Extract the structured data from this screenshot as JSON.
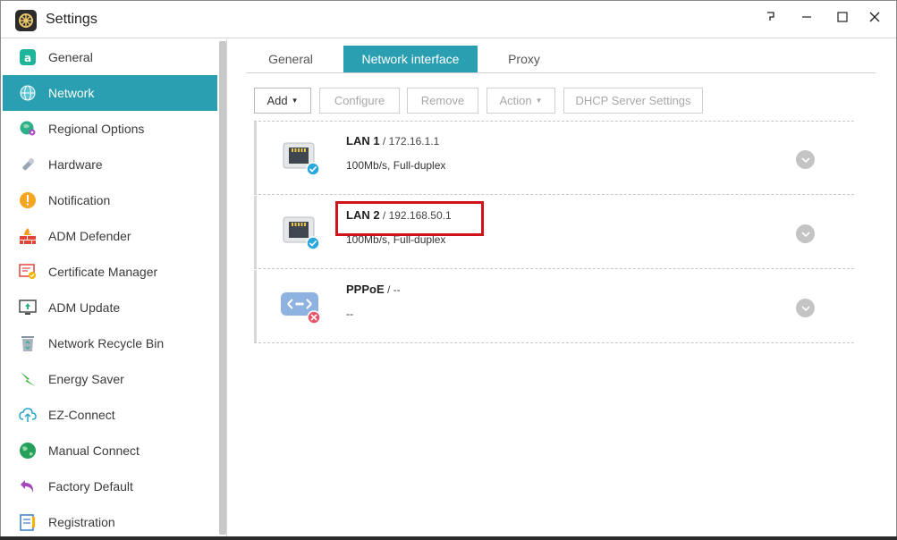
{
  "window": {
    "title": "Settings",
    "controls": {
      "help": "help-icon",
      "minimize": "minimize-icon",
      "maximize": "maximize-icon",
      "close": "close-icon"
    }
  },
  "sidebar": {
    "active_color": "#2a9fb1",
    "items": [
      {
        "label": "General",
        "icon": "general-icon"
      },
      {
        "label": "Network",
        "icon": "globe-icon",
        "active": true
      },
      {
        "label": "Regional Options",
        "icon": "globe-pin-icon"
      },
      {
        "label": "Hardware",
        "icon": "wrench-icon"
      },
      {
        "label": "Notification",
        "icon": "alert-icon"
      },
      {
        "label": "ADM Defender",
        "icon": "firewall-icon"
      },
      {
        "label": "Certificate Manager",
        "icon": "certificate-icon"
      },
      {
        "label": "ADM Update",
        "icon": "update-monitor-icon"
      },
      {
        "label": "Network Recycle Bin",
        "icon": "recycle-bin-icon"
      },
      {
        "label": "Energy Saver",
        "icon": "energy-icon"
      },
      {
        "label": "EZ-Connect",
        "icon": "cloud-upload-icon"
      },
      {
        "label": "Manual Connect",
        "icon": "globe-green-icon"
      },
      {
        "label": "Factory Default",
        "icon": "undo-arrow-icon"
      },
      {
        "label": "Registration",
        "icon": "clipboard-icon"
      }
    ]
  },
  "tabs": [
    {
      "label": "General"
    },
    {
      "label": "Network interface",
      "active": true
    },
    {
      "label": "Proxy"
    }
  ],
  "toolbar": {
    "add": "Add",
    "configure": "Configure",
    "remove": "Remove",
    "action": "Action",
    "dhcp": "DHCP Server Settings"
  },
  "interfaces": [
    {
      "name": "LAN 1",
      "address": " / 172.16.1.1",
      "detail": "100Mb/s, Full-duplex",
      "icon": "ethernet-port-icon",
      "status": "connected"
    },
    {
      "name": "LAN 2",
      "address": " / 192.168.50.1",
      "detail": "100Mb/s, Full-duplex",
      "icon": "ethernet-port-icon",
      "status": "connected"
    },
    {
      "name": "PPPoE",
      "address": " / --",
      "detail": "--",
      "icon": "pppoe-icon",
      "status": "disconnected"
    }
  ]
}
